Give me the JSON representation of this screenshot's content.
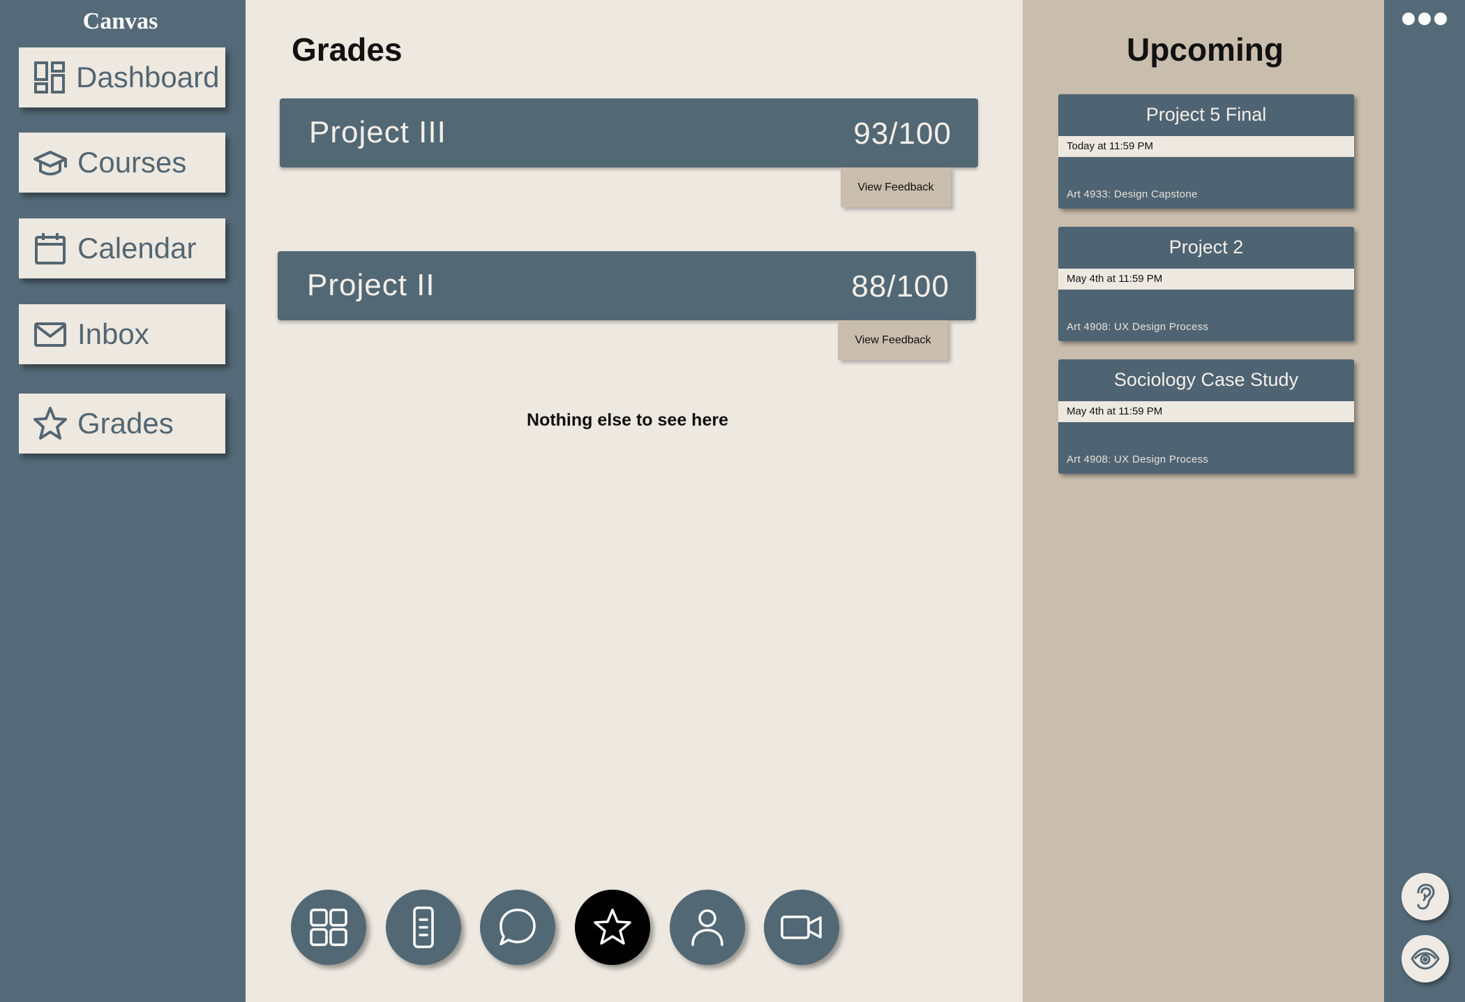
{
  "sidebar": {
    "brand": "Canvas",
    "items": [
      {
        "label": "Dashboard",
        "icon": "dashboard-icon"
      },
      {
        "label": "Courses",
        "icon": "graduation-cap-icon"
      },
      {
        "label": "Calendar",
        "icon": "calendar-icon"
      },
      {
        "label": "Inbox",
        "icon": "mail-icon"
      },
      {
        "label": "Grades",
        "icon": "star-icon"
      }
    ]
  },
  "main": {
    "title": "Grades",
    "grades": [
      {
        "name": "Project III",
        "score": "93/100",
        "feedback_label": "View Feedback"
      },
      {
        "name": "Project II",
        "score": "88/100",
        "feedback_label": "View Feedback"
      }
    ],
    "empty_message": "Nothing else to see here"
  },
  "bottom_nav": [
    {
      "icon": "grid-icon",
      "active": false
    },
    {
      "icon": "document-icon",
      "active": false
    },
    {
      "icon": "chat-bubble-icon",
      "active": false
    },
    {
      "icon": "star-icon",
      "active": true
    },
    {
      "icon": "person-icon",
      "active": false
    },
    {
      "icon": "video-camera-icon",
      "active": false
    }
  ],
  "upcoming": {
    "title": "Upcoming",
    "items": [
      {
        "name": "Project 5 Final",
        "due": "Today at 11:59 PM",
        "course": "Art 4933: Design Capstone"
      },
      {
        "name": "Project 2",
        "due": "May 4th at 11:59 PM",
        "course": "Art 4908: UX Design Process"
      },
      {
        "name": "Sociology Case Study",
        "due": "May 4th at 11:59 PM",
        "course": "Art 4908: UX Design Process"
      }
    ]
  },
  "rail": {
    "more_icon": "more-dots-icon",
    "accessibility": [
      "ear-icon",
      "eye-icon"
    ]
  },
  "colors": {
    "slate": "#546a78",
    "cream": "#ede8e0",
    "tan": "#c9bdad",
    "active": "#000000"
  }
}
